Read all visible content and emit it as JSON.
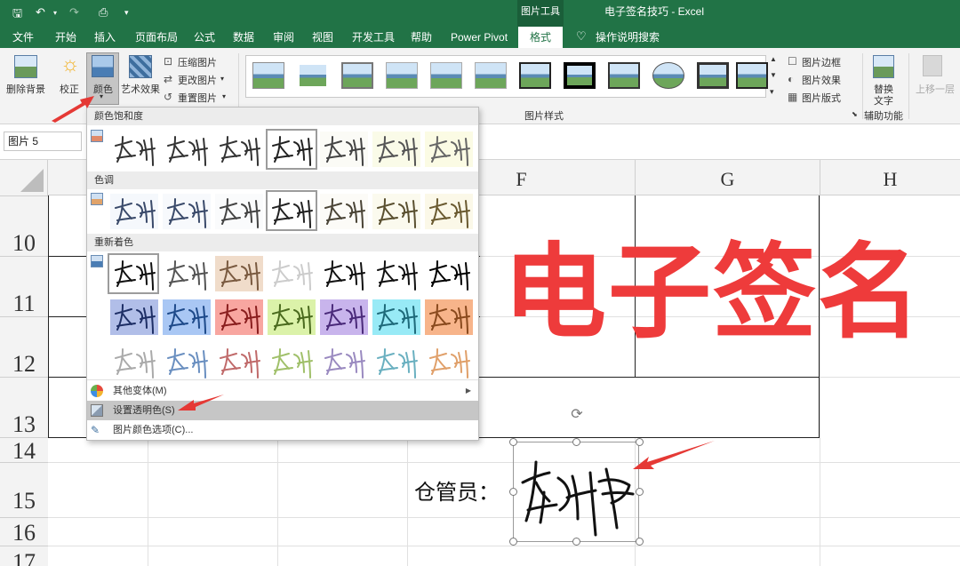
{
  "window": {
    "doc_title": "电子签名技巧 - Excel",
    "picture_tools": "图片工具"
  },
  "tabs": [
    "文件",
    "开始",
    "插入",
    "页面布局",
    "公式",
    "数据",
    "审阅",
    "视图",
    "开发工具",
    "帮助",
    "Power Pivot",
    "格式",
    "操作说明搜索"
  ],
  "ribbon": {
    "remove_bg": "删除背景",
    "correct": "校正",
    "color": "颜色",
    "artistic": "艺术效果",
    "compress": "压缩图片",
    "change": "更改图片",
    "reset": "重置图片",
    "styles_group": "图片样式",
    "border": "图片边框",
    "effects": "图片效果",
    "layout": "图片版式",
    "alt_text_1": "替换",
    "alt_text_2": "文字",
    "accessibility": "辅助功能",
    "bring_forward": "上移一层"
  },
  "namebox": "图片 5",
  "columns": [
    "F",
    "G",
    "H"
  ],
  "rows": [
    "10",
    "11",
    "12",
    "13",
    "14",
    "15",
    "16",
    "17"
  ],
  "sheet": {
    "title_text": "电子签名",
    "keeper_label": "仓管员：",
    "signature": "李朝伟"
  },
  "menu": {
    "saturation": "颜色饱和度",
    "tone": "色调",
    "recolor": "重新着色",
    "more": "其他变体(M)",
    "transparent": "设置透明色(S)",
    "options": "图片颜色选项(C)..."
  },
  "colors": {
    "excel_green": "#217346",
    "title_red": "#ee3b3b",
    "arrow_red": "#e53935"
  },
  "swatches": {
    "saturation": [
      "#ffffff",
      "#ffffff",
      "#ffffff",
      "#ffffff",
      "#fbfbf6",
      "#fafbe8",
      "#fbfbe4"
    ],
    "tone": [
      "#f5f8fc",
      "#f7f9fc",
      "#fafbfc",
      "#ffffff",
      "#fcfbf7",
      "#fbfaee",
      "#fbf8e8"
    ],
    "recolor_row1": [
      "#ffffff",
      "#ffffff",
      "#f0dcca",
      "#ffffff",
      "#ffffff",
      "#ffffff",
      "#ffffff"
    ],
    "recolor_row2": [
      "#b1bee8",
      "#a9c7f4",
      "#f8a6a0",
      "#dbf2a9",
      "#c8b4ec",
      "#98eaf6",
      "#f7b48a"
    ],
    "recolor_row3": [
      "#ffffff",
      "#ffffff",
      "#ffffff",
      "#ffffff",
      "#ffffff",
      "#ffffff",
      "#ffffff"
    ]
  }
}
